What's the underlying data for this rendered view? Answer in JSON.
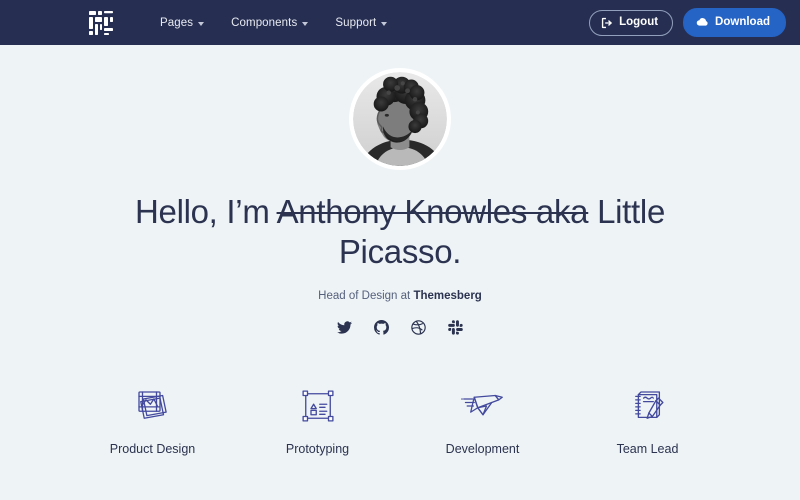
{
  "navbar": {
    "logo_icon": "grid-blocks-logo",
    "links": [
      {
        "label": "Pages",
        "icon": "chevron-down-icon"
      },
      {
        "label": "Components",
        "icon": "chevron-down-icon"
      },
      {
        "label": "Support",
        "icon": "chevron-down-icon"
      }
    ],
    "logout": {
      "label": "Logout",
      "icon": "sign-out-icon"
    },
    "download": {
      "label": "Download",
      "icon": "cloud-download-icon"
    },
    "colors": {
      "background": "#262f52",
      "download_button": "#2563c4",
      "link_text": "#e8eaf1"
    }
  },
  "hero": {
    "avatar_alt": "profile-photo",
    "greeting": "Hello, I’m ",
    "struck_name": "Anthony Knowles aka",
    "real_name": " Little Picasso.",
    "subtitle_prefix": "Head of Design at ",
    "subtitle_link": "Themesberg",
    "socials": [
      {
        "name": "twitter-icon",
        "label": "Twitter"
      },
      {
        "name": "github-icon",
        "label": "GitHub"
      },
      {
        "name": "dribbble-icon",
        "label": "Dribbble"
      },
      {
        "name": "slack-icon",
        "label": "Slack"
      }
    ]
  },
  "features": [
    {
      "label": "Product Design",
      "icon": "artboards-stack-icon"
    },
    {
      "label": "Prototyping",
      "icon": "wireframe-icon"
    },
    {
      "label": "Development",
      "icon": "origami-bird-icon"
    },
    {
      "label": "Team Lead",
      "icon": "notepad-pencil-icon"
    }
  ],
  "colors": {
    "page_background": "#eef3f5",
    "heading": "#2b3350",
    "feature_icon": "#434a9e"
  }
}
